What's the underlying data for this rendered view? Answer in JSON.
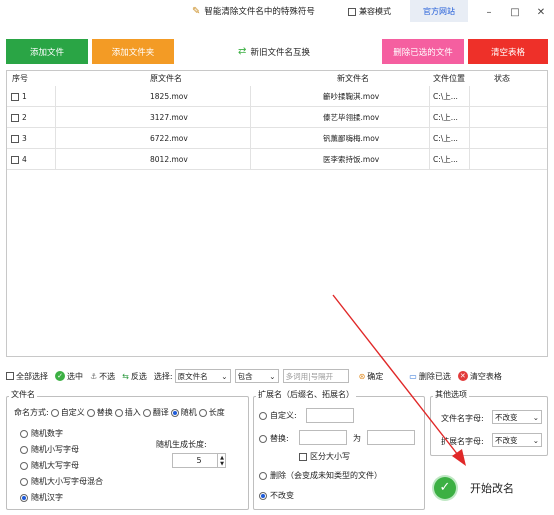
{
  "titlebar": {
    "title": "智能清除文件名中的特殊符号",
    "compat_label": "兼容模式",
    "official_site": "官方网站",
    "minimize": "–",
    "maximize": "□",
    "close": "✕"
  },
  "top_buttons": {
    "add_file": "添加文件",
    "add_folder": "添加文件夹",
    "swap_names": "新旧文件名互换",
    "delete_selected": "删除已选的文件",
    "clear_table": "清空表格"
  },
  "table": {
    "headers": [
      "序号",
      "原文件名",
      "新文件名",
      "文件位置",
      "状态"
    ],
    "rows": [
      {
        "idx": "1",
        "orig": "1825.mov",
        "new": "籪吵揉鞠淇.mov",
        "loc": "C:\\上...",
        "status": ""
      },
      {
        "idx": "2",
        "orig": "3127.mov",
        "new": "傣艺毕翎揉.mov",
        "loc": "C:\\上...",
        "status": ""
      },
      {
        "idx": "3",
        "orig": "6722.mov",
        "new": "钒薰鄙嗨梅.mov",
        "loc": "C:\\上...",
        "status": ""
      },
      {
        "idx": "4",
        "orig": "8012.mov",
        "new": "医李索持饭.mov",
        "loc": "C:\\上...",
        "status": ""
      }
    ]
  },
  "toolbar": {
    "select_all": "全部选择",
    "select": "选中",
    "unselect": "不选",
    "invert": "反选",
    "choose_label": "选择:",
    "field_select": "原文件名",
    "match_select": "包含",
    "multi_placeholder": "多词用|号隔开",
    "confirm": "确定",
    "delete_selected": "删除已选",
    "clear_table": "清空表格"
  },
  "filename_group": {
    "title": "文件名",
    "mode_label": "命名方式:",
    "modes": [
      "自定义",
      "替换",
      "插入",
      "翻译",
      "随机",
      "长度"
    ],
    "random_options": [
      "随机数字",
      "随机小写字母",
      "随机大写字母",
      "随机大小写字母混合",
      "随机汉字"
    ],
    "length_label": "随机生成长度:",
    "length_value": "5"
  },
  "ext_group": {
    "title": "扩展名（后缀名、拓展名）",
    "custom": "自定义:",
    "replace": "替换:",
    "to": "为",
    "case_sensitive": "区分大小写",
    "delete": "删除（会变成未知类型的文件）",
    "unchanged": "不改变"
  },
  "other_group": {
    "title": "其他选项",
    "name_case_label": "文件名字母:",
    "name_case_value": "不改变",
    "ext_case_label": "扩展名字母:",
    "ext_case_value": "不改变"
  },
  "start_button": "开始改名",
  "colors": {
    "add_file": "#2aa545",
    "add_folder": "#f39b25",
    "delete_selected": "#f55fa0",
    "clear_table": "#ee3029"
  }
}
